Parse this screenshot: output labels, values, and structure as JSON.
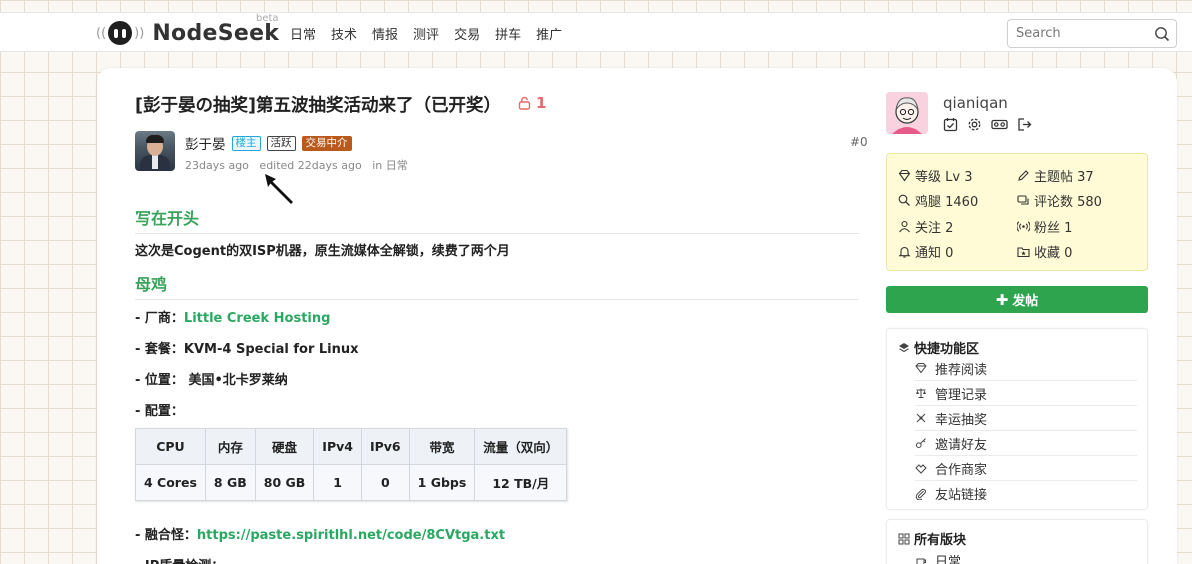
{
  "header": {
    "logo_text": "NodeSeek",
    "logo_beta": "beta",
    "nav": [
      "日常",
      "技术",
      "情报",
      "测评",
      "交易",
      "拼车",
      "推广"
    ],
    "search_placeholder": "Search"
  },
  "post": {
    "title": "[彭于晏の抽奖]第五波抽奖活动来了（已开奖）",
    "lock_count": "1",
    "author": "彭于晏",
    "badges": [
      "楼主",
      "活跃",
      "交易中介"
    ],
    "time": "23days ago",
    "edited": "edited 22days ago",
    "category": "in 日常",
    "floor": "#0",
    "section1_title": "写在开头",
    "intro": "这次是Cogent的双ISP机器，原生流媒体全解锁，续费了两个月",
    "section2_title": "母鸡",
    "vendor_label": "- 厂商：",
    "vendor_link": "Little Creek Hosting",
    "plan": "- 套餐：KVM-4 Special for Linux",
    "location": "- 位置： 美国•北卡罗莱纳",
    "config": "- 配置：",
    "table": {
      "headers": [
        "CPU",
        "内存",
        "硬盘",
        "IPv4",
        "IPv6",
        "带宽",
        "流量（双向）"
      ],
      "row": [
        "4 Cores",
        "8 GB",
        "80 GB",
        "1",
        "0",
        "1 Gbps",
        "12 TB/月"
      ]
    },
    "fusion_label": "- 融合怪：",
    "fusion_link": "https://paste.spiritlhl.net/code/8CVtga.txt",
    "ip_check": "- IP质量检测："
  },
  "user": {
    "name": "qianiqan",
    "stats": {
      "level": "等级 Lv 3",
      "topics": "主题帖 37",
      "chicken": "鸡腿 1460",
      "comments": "评论数 580",
      "following": "关注 2",
      "fans": "粉丝 1",
      "notify": "通知 0",
      "favorites": "收藏 0"
    }
  },
  "sidebar": {
    "post_button": "发帖",
    "quick_title": "快捷功能区",
    "quick_items": [
      "推荐阅读",
      "管理记录",
      "幸运抽奖",
      "邀请好友",
      "合作商家",
      "友站链接"
    ],
    "boards_title": "所有版块",
    "board_items": [
      "日常"
    ]
  },
  "colors": {
    "accent_green": "#2ea44f",
    "heading_green": "#3aa25a",
    "link_green": "#2aa862",
    "lock_red": "#e66a6a",
    "stats_bg": "#fefbd6"
  }
}
